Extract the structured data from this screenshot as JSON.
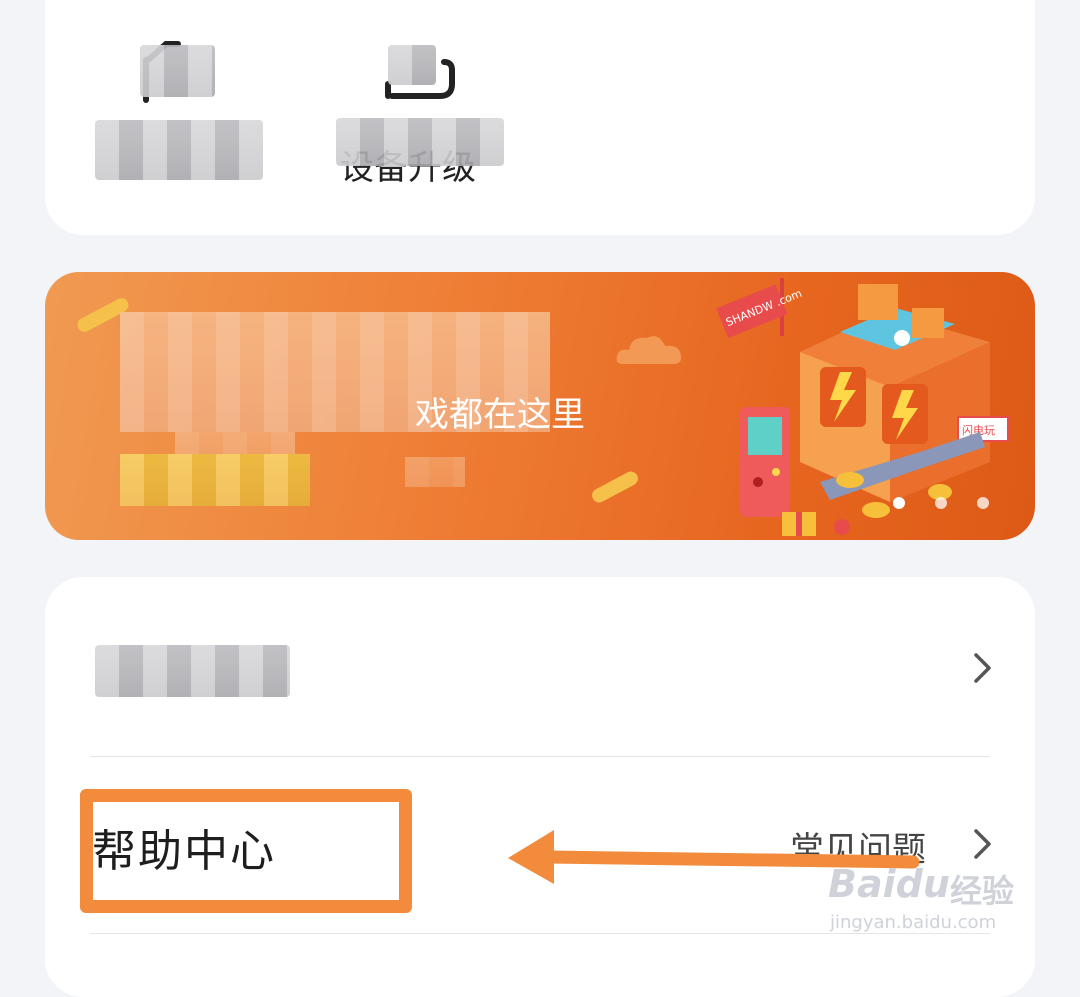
{
  "shortcuts": [
    {
      "label": "",
      "icon": "shortcut-icon"
    },
    {
      "label": "设备升级",
      "icon": "cloud-icon"
    }
  ],
  "banner": {
    "text": "戏都在这里",
    "site_flag": "SHANDW .com",
    "shop_sign": "闪电玩",
    "page_dots": 3,
    "active_dot": 1
  },
  "menu": {
    "items": [
      {
        "label": "",
        "sub": ""
      },
      {
        "label": "帮助中心",
        "sub": "常见问题"
      }
    ]
  },
  "annotation": {
    "color": "#f28b3c"
  },
  "watermark": {
    "brand": "Baidu",
    "cn": "经验",
    "url": "jingyan.baidu.com"
  }
}
